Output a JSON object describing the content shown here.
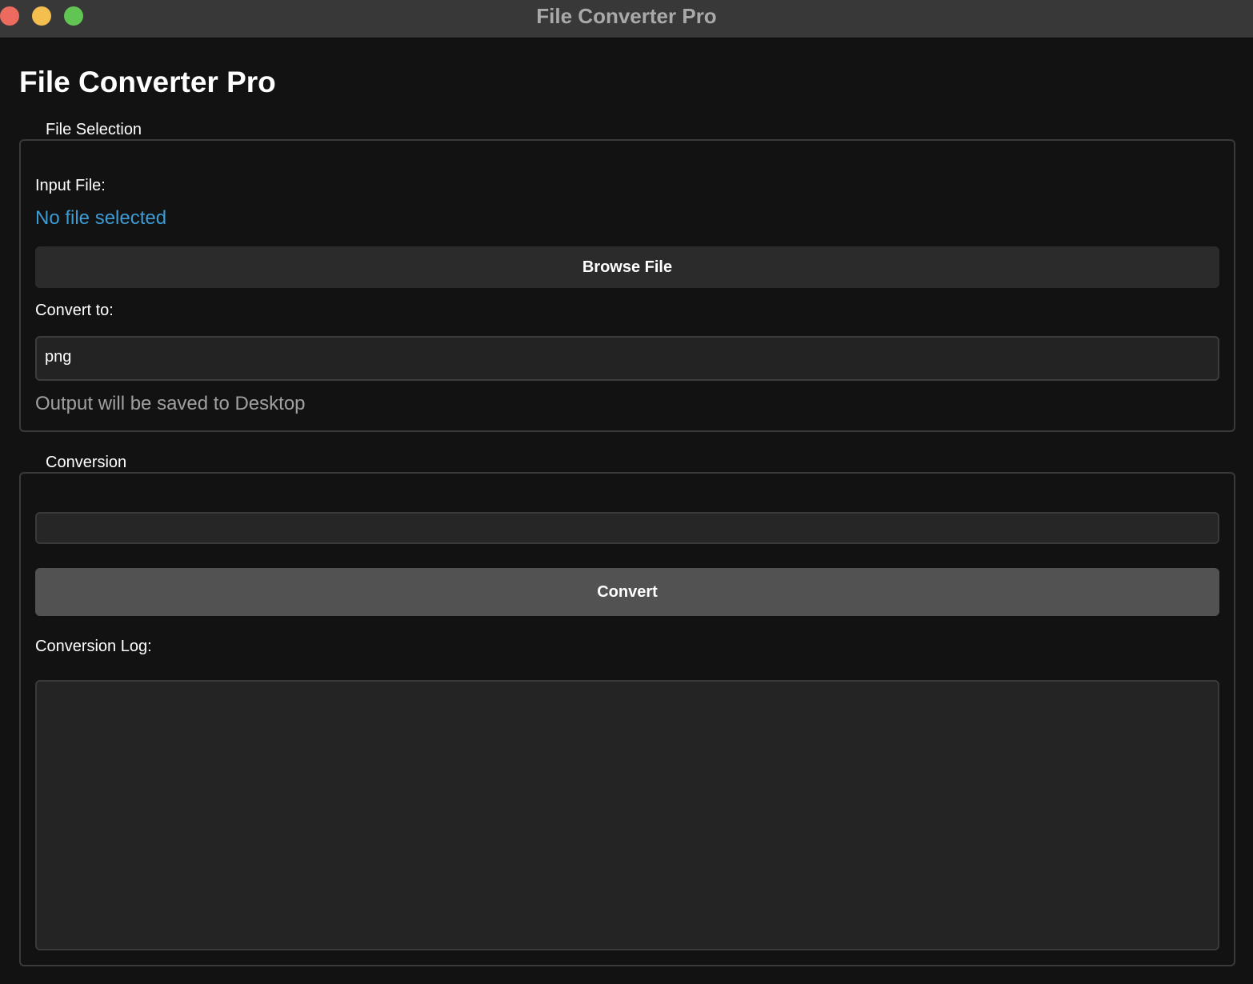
{
  "window": {
    "title": "File Converter Pro"
  },
  "app": {
    "title": "File Converter Pro"
  },
  "file_selection": {
    "legend": "File Selection",
    "input_label": "Input File:",
    "file_status": "No file selected",
    "browse_label": "Browse File",
    "convert_to_label": "Convert to:",
    "format_value": "png",
    "output_hint": "Output will be saved to Desktop"
  },
  "conversion": {
    "legend": "Conversion",
    "progress": 0,
    "convert_label": "Convert",
    "log_label": "Conversion Log:",
    "log_text": ""
  },
  "colors": {
    "background": "#121212",
    "titlebar": "#383838",
    "accent_link": "#3d9bd4",
    "close": "#ed6a5e",
    "minimize": "#f5bf4f",
    "zoom": "#61c554"
  }
}
